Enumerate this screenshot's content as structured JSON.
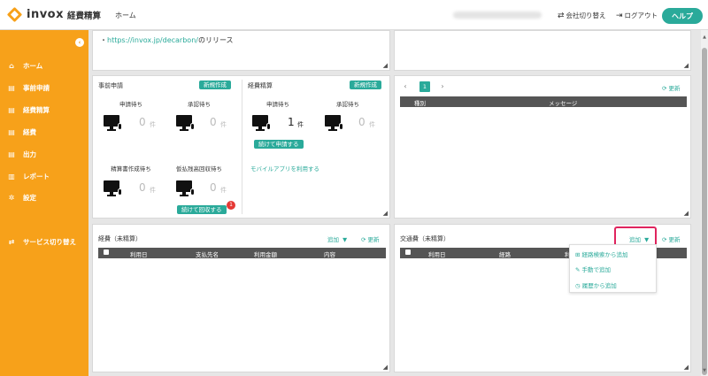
{
  "app": {
    "logo_text": "invox",
    "logo_sub": "経費精算"
  },
  "header": {
    "home": "ホーム",
    "switch_company": "会社切り替え",
    "logout": "ログアウト",
    "help": "ヘルプ"
  },
  "sidebar": {
    "items": [
      {
        "label": "ホーム",
        "icon": "home-icon"
      },
      {
        "label": "事前申請",
        "icon": "document-icon"
      },
      {
        "label": "経費精算",
        "icon": "document-icon"
      },
      {
        "label": "経費",
        "icon": "document-icon"
      },
      {
        "label": "出力",
        "icon": "download-icon"
      },
      {
        "label": "レポート",
        "icon": "chart-icon"
      },
      {
        "label": "設定",
        "icon": "gear-icon"
      }
    ],
    "service_switch": "サービス切り替え"
  },
  "notice": {
    "bullet": "・",
    "link": "https://invox.jp/decarbon/",
    "suffix": "のリリース"
  },
  "pre_application": {
    "title": "事前申請",
    "new_button": "新規作成",
    "stats": [
      {
        "label": "申請待ち",
        "count": "0",
        "unit": "件"
      },
      {
        "label": "承認待ち",
        "count": "0",
        "unit": "件"
      },
      {
        "label": "精算書作成待ち",
        "count": "0",
        "unit": "件"
      },
      {
        "label": "仮払残高回収待ち",
        "count": "0",
        "unit": "件"
      }
    ],
    "collect_button": "続けて回収する",
    "collect_badge": "1"
  },
  "expense_settlement": {
    "title": "経費精算",
    "new_button": "新規作成",
    "stats": [
      {
        "label": "申請待ち",
        "count": "1",
        "unit": "件"
      },
      {
        "label": "承認待ち",
        "count": "0",
        "unit": "件"
      }
    ],
    "apply_button": "続けて申請する",
    "mobile_link": "モバイルアプリを利用する"
  },
  "messages": {
    "page": "1",
    "refresh": "更新",
    "columns": [
      "種別",
      "メッセージ"
    ]
  },
  "expenses": {
    "title": "経費（未精算）",
    "add": "追加",
    "refresh": "更新",
    "columns": [
      "利用日",
      "支払先名",
      "利用金額",
      "内容"
    ]
  },
  "transport": {
    "title": "交通費（未精算）",
    "add": "追加",
    "refresh": "更新",
    "columns": [
      "利用日",
      "経路",
      "利"
    ],
    "dropdown": [
      "経路検索から追加",
      "手動で追加",
      "履歴から追加"
    ]
  },
  "colors": {
    "accent": "#f7a11a",
    "teal": "#2aaa9a",
    "highlight": "#e0245e"
  }
}
